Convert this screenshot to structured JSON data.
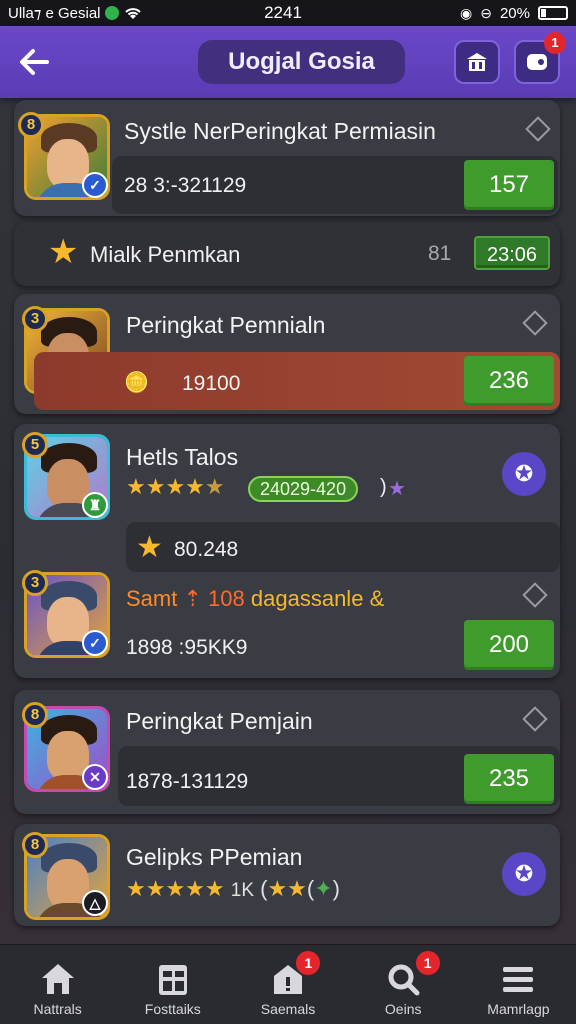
{
  "status_bar": {
    "left_text": "Ulla⁊ e Gesial",
    "time": "2241",
    "battery": "20%",
    "battery_level": 0.2
  },
  "header": {
    "title": "Uogjal Gosia",
    "right_badge_count": "1"
  },
  "cards": [
    {
      "rank": "8",
      "name": "Systle NerPeringkat Permiasin",
      "stat": "28 3:-321129",
      "score": "157"
    },
    {
      "section_label": "Mialk Penmkan",
      "section_num": "81",
      "section_score": "23:06"
    },
    {
      "rank": "3",
      "name": "Peringkat Pemnialn",
      "stat": "19100",
      "score": "236"
    },
    {
      "rank": "5",
      "name": "Hetls Talos",
      "rating_pill": "24029-420",
      "rating_suffix": ")",
      "star_value": "80.248",
      "rank2": "3",
      "highlight_text": "Samt",
      "highlight_num": "108",
      "highlight_text2": "dagassanle",
      "highlight_suffix": "&",
      "stat2": "1898 :95KK9",
      "score": "200"
    },
    {
      "rank": "8",
      "name": "Peringkat Pemjain",
      "stat": "1878-131129",
      "score": "235"
    },
    {
      "rank": "8",
      "name": "Gelipks PPemian",
      "suffix_text": "1K"
    }
  ],
  "bottom_nav": [
    {
      "label": "Nattrals",
      "icon": "home-icon"
    },
    {
      "label": "Fosttaiks",
      "icon": "clipboard-icon"
    },
    {
      "label": "Saemals",
      "icon": "house-alert-icon",
      "badge": "1"
    },
    {
      "label": "Oeins",
      "icon": "magnifier-icon",
      "badge": "1"
    },
    {
      "label": "Mamrlagp",
      "icon": "menu-icon"
    }
  ],
  "colors": {
    "header": "#6a48c9",
    "score_green": "#3f9b2c",
    "badge_red": "#e3262d",
    "card_bg": "#3a3c43"
  }
}
